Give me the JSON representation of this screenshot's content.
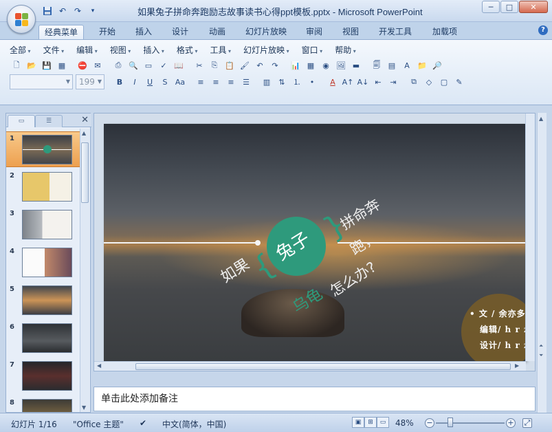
{
  "window": {
    "title": "如果兔子拼命奔跑励志故事读书心得ppt模板.pptx - Microsoft PowerPoint",
    "minimize": "─",
    "maximize": "□",
    "close": "✕"
  },
  "quick_access": [
    "save-icon",
    "undo-icon",
    "redo-icon",
    "customize-icon"
  ],
  "tabs": [
    "经典菜单",
    "开始",
    "插入",
    "设计",
    "动画",
    "幻灯片放映",
    "审阅",
    "视图",
    "开发工具",
    "加载项"
  ],
  "active_tab": "经典菜单",
  "classic_menu": [
    "全部",
    "文件",
    "编辑",
    "视图",
    "插入",
    "格式",
    "工具",
    "幻灯片放映",
    "窗口",
    "帮助"
  ],
  "font": {
    "name": "",
    "size": "199"
  },
  "thumbnails": {
    "numbers": [
      "1",
      "2",
      "3",
      "4",
      "5",
      "6",
      "7",
      "8"
    ],
    "selected": 1
  },
  "slide": {
    "text_rugu": "如果",
    "text_tuzi": "兔子",
    "text_pinming": "拼命奔",
    "text_pao": "跑，",
    "text_wugui": "乌龟",
    "text_zenmeban": "怎么办?",
    "credit_author": "•  文 / 余亦多",
    "credit_editor": "编辑/ h r z",
    "credit_design": "设计/ h r z",
    "accent_color": "#2e9a7c"
  },
  "notes_placeholder": "单击此处添加备注",
  "status": {
    "slide_info": "幻灯片 1/16",
    "theme": "\"Office 主题\"",
    "language": "中文(简体，中国)",
    "zoom": "48%"
  }
}
